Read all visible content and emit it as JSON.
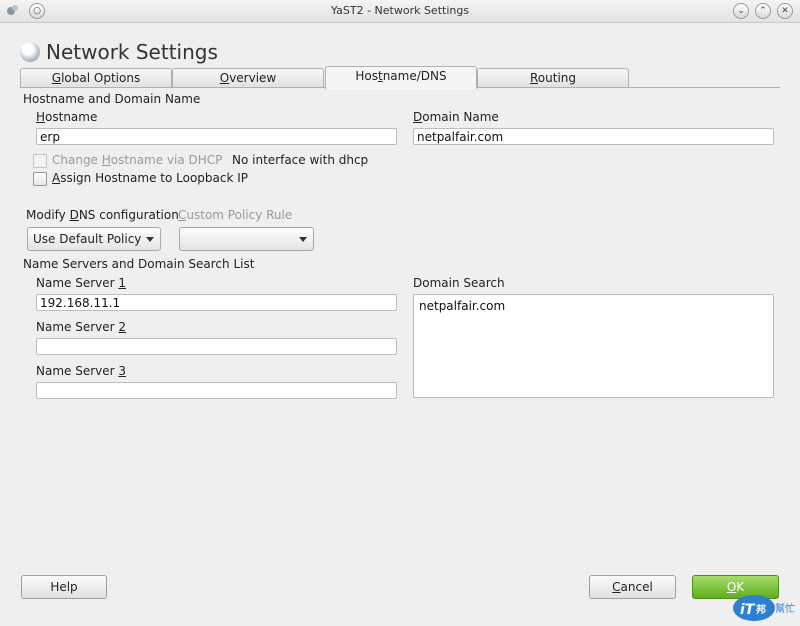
{
  "window": {
    "title": "YaST2 - Network Settings"
  },
  "heading": "Network Settings",
  "tabs": [
    "Global Options",
    "Overview",
    "Hostname/DNS",
    "Routing"
  ],
  "active_tab": "Hostname/DNS",
  "hostname_section": {
    "title": "Hostname and Domain Name",
    "hostname_label": "Hostname",
    "hostname_value": "erp",
    "domain_label": "Domain Name",
    "domain_value": "netpalfair.com",
    "change_via_dhcp_label": "Change Hostname via DHCP",
    "no_interface_note": "No interface with dhcp",
    "assign_loopback_label": "Assign Hostname to Loopback IP"
  },
  "dns_config": {
    "modify_label": "Modify DNS configuration",
    "modify_value": "Use Default Policy",
    "custom_policy_label": "Custom Policy Rule",
    "custom_policy_value": ""
  },
  "nameservers_section": {
    "title": "Name Servers and Domain Search List",
    "ns1_label": "Name Server 1",
    "ns1_value": "192.168.11.1",
    "ns2_label": "Name Server 2",
    "ns2_value": "",
    "ns3_label": "Name Server 3",
    "ns3_value": "",
    "domain_search_label": "Domain Search",
    "domain_search_value": "netpalfair.com"
  },
  "buttons": {
    "help": "Help",
    "cancel": "Cancel",
    "ok": "OK"
  },
  "watermark": {
    "text1": "iT",
    "text2": "邦",
    "text3": "幫忙"
  },
  "colors": {
    "ok_button": "#6cbb2a",
    "window_bg": "#efefef"
  }
}
